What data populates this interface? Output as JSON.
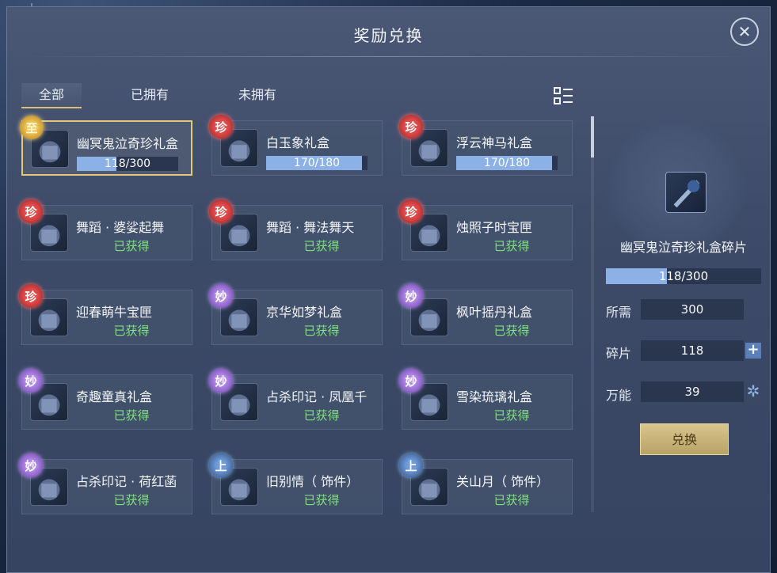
{
  "window": {
    "title": "奖励兑换"
  },
  "tabs": [
    {
      "label": "全部",
      "active": true
    },
    {
      "label": "已拥有",
      "active": false
    },
    {
      "label": "未拥有",
      "active": false
    }
  ],
  "items": [
    {
      "name": "幽冥鬼泣奇珍礼盒",
      "badge": "至",
      "badge_color": "gold",
      "progress": "118/300",
      "progress_value": 118,
      "progress_max": 300,
      "selected": true
    },
    {
      "name": "白玉象礼盒",
      "badge": "珍",
      "badge_color": "red",
      "progress": "170/180",
      "progress_value": 170,
      "progress_max": 180
    },
    {
      "name": "浮云神马礼盒",
      "badge": "珍",
      "badge_color": "red",
      "progress": "170/180",
      "progress_value": 170,
      "progress_max": 180
    },
    {
      "name": "舞蹈 · 婆娑起舞",
      "badge": "珍",
      "badge_color": "red",
      "status": "已获得"
    },
    {
      "name": "舞蹈 · 舞法舞天",
      "badge": "珍",
      "badge_color": "red",
      "status": "已获得"
    },
    {
      "name": "烛照子时宝匣",
      "badge": "珍",
      "badge_color": "red",
      "status": "已获得"
    },
    {
      "name": "迎春萌牛宝匣",
      "badge": "珍",
      "badge_color": "red",
      "status": "已获得"
    },
    {
      "name": "京华如梦礼盒",
      "badge": "妙",
      "badge_color": "purple",
      "status": "已获得"
    },
    {
      "name": "枫叶摇丹礼盒",
      "badge": "妙",
      "badge_color": "purple",
      "status": "已获得"
    },
    {
      "name": "奇趣童真礼盒",
      "badge": "妙",
      "badge_color": "purple",
      "status": "已获得"
    },
    {
      "name": "占杀印记 · 凤凰千",
      "badge": "妙",
      "badge_color": "purple",
      "status": "已获得"
    },
    {
      "name": "雪染琉璃礼盒",
      "badge": "妙",
      "badge_color": "purple",
      "status": "已获得"
    },
    {
      "name": "占杀印记 · 荷红菡",
      "badge": "妙",
      "badge_color": "purple",
      "status": "已获得"
    },
    {
      "name": "旧别情（ 饰件）",
      "badge": "上",
      "badge_color": "blue",
      "status": "已获得"
    },
    {
      "name": "关山月（ 饰件）",
      "badge": "上",
      "badge_color": "blue",
      "status": "已获得"
    }
  ],
  "detail": {
    "name": "幽冥鬼泣奇珍礼盒碎片",
    "progress": "118/300",
    "progress_value": 118,
    "progress_max": 300,
    "required_label": "所需",
    "required_value": "300",
    "fragments_label": "碎片",
    "fragments_value": "118",
    "universal_label": "万能",
    "universal_value": "39",
    "exchange_label": "兑换"
  },
  "icons": {
    "close": "close-icon",
    "filter": "filter-list-icon",
    "add": "plus-icon",
    "universal": "snowflake-icon"
  }
}
